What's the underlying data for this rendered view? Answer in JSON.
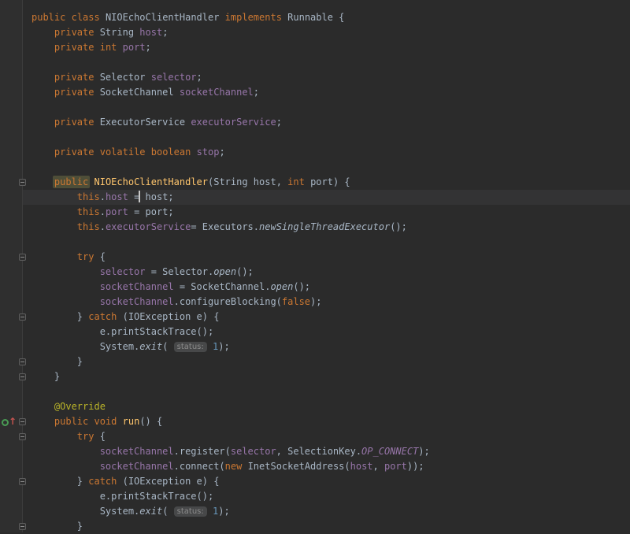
{
  "app": {
    "name": "intellij-code-editor",
    "language": "java",
    "theme": "darcula"
  },
  "colors": {
    "editor_bg": "#2B2B2B",
    "gutter_bg": "#2F2F2F",
    "gutter_border": "#3C3C3C",
    "current_line": "#333334",
    "keyword": "#CC7832",
    "text": "#A9B7C6",
    "field": "#9876AA",
    "method_decl": "#FFC66D",
    "annotation": "#BBB529",
    "number": "#6897BB",
    "hint_bg": "#474849",
    "hint_text": "#8C8C8C",
    "caret": "#C8C8C8",
    "highlight_bg": "#4E4E38",
    "fold_border": "#5E5E5E",
    "override_green": "#499C54",
    "override_red": "#C75450"
  },
  "editor": {
    "caret_line": 13,
    "gutter": {
      "fold_lines": [
        12,
        17,
        21,
        24,
        25,
        28,
        29,
        32,
        35
      ],
      "override_line": 28,
      "override_icon": "overrides-method-icon"
    },
    "lines": [
      {
        "indent": 0,
        "tokens": [
          [
            "kw",
            "public"
          ],
          [
            "txt",
            " "
          ],
          [
            "kw",
            "class"
          ],
          [
            "txt",
            " NIOEchoClientHandler "
          ],
          [
            "kw",
            "implements"
          ],
          [
            "txt",
            " Runnable {"
          ]
        ]
      },
      {
        "indent": 4,
        "tokens": [
          [
            "kw",
            "private"
          ],
          [
            "txt",
            " String "
          ],
          [
            "fld",
            "host"
          ],
          [
            "txt",
            ";"
          ]
        ]
      },
      {
        "indent": 4,
        "tokens": [
          [
            "kw",
            "private"
          ],
          [
            "txt",
            " "
          ],
          [
            "kw",
            "int"
          ],
          [
            "txt",
            " "
          ],
          [
            "fld",
            "port"
          ],
          [
            "txt",
            ";"
          ]
        ]
      },
      {
        "indent": 0,
        "tokens": []
      },
      {
        "indent": 4,
        "tokens": [
          [
            "kw",
            "private"
          ],
          [
            "txt",
            " Selector "
          ],
          [
            "fld",
            "selector"
          ],
          [
            "txt",
            ";"
          ]
        ]
      },
      {
        "indent": 4,
        "tokens": [
          [
            "kw",
            "private"
          ],
          [
            "txt",
            " SocketChannel "
          ],
          [
            "fld",
            "socketChannel"
          ],
          [
            "txt",
            ";"
          ]
        ]
      },
      {
        "indent": 0,
        "tokens": []
      },
      {
        "indent": 4,
        "tokens": [
          [
            "kw",
            "private"
          ],
          [
            "txt",
            " ExecutorService "
          ],
          [
            "fld",
            "executorService"
          ],
          [
            "txt",
            ";"
          ]
        ]
      },
      {
        "indent": 0,
        "tokens": []
      },
      {
        "indent": 4,
        "tokens": [
          [
            "kw",
            "private"
          ],
          [
            "txt",
            " "
          ],
          [
            "kw",
            "volatile"
          ],
          [
            "txt",
            " "
          ],
          [
            "kw",
            "boolean"
          ],
          [
            "txt",
            " "
          ],
          [
            "fld",
            "stop"
          ],
          [
            "txt",
            ";"
          ]
        ]
      },
      {
        "indent": 0,
        "tokens": []
      },
      {
        "indent": 4,
        "tokens": [
          [
            "hlkw",
            "public"
          ],
          [
            "txt",
            " "
          ],
          [
            "mth",
            "NIOEchoClientHandler"
          ],
          [
            "txt",
            "(String host, "
          ],
          [
            "kw",
            "int"
          ],
          [
            "txt",
            " port) {"
          ]
        ]
      },
      {
        "indent": 8,
        "tokens": [
          [
            "kw",
            "this"
          ],
          [
            "txt",
            "."
          ],
          [
            "fld",
            "host"
          ],
          [
            "txt",
            " ="
          ],
          [
            "caret",
            ""
          ],
          [
            "txt",
            " host;"
          ]
        ]
      },
      {
        "indent": 8,
        "tokens": [
          [
            "kw",
            "this"
          ],
          [
            "txt",
            "."
          ],
          [
            "fld",
            "port"
          ],
          [
            "txt",
            " = port;"
          ]
        ]
      },
      {
        "indent": 8,
        "tokens": [
          [
            "kw",
            "this"
          ],
          [
            "txt",
            "."
          ],
          [
            "fld",
            "executorService"
          ],
          [
            "txt",
            "= Executors."
          ],
          [
            "stat",
            "newSingleThreadExecutor"
          ],
          [
            "txt",
            "();"
          ]
        ]
      },
      {
        "indent": 0,
        "tokens": []
      },
      {
        "indent": 8,
        "tokens": [
          [
            "kw",
            "try"
          ],
          [
            "txt",
            " {"
          ]
        ]
      },
      {
        "indent": 12,
        "tokens": [
          [
            "fld",
            "selector"
          ],
          [
            "txt",
            " = Selector."
          ],
          [
            "stat",
            "open"
          ],
          [
            "txt",
            "();"
          ]
        ]
      },
      {
        "indent": 12,
        "tokens": [
          [
            "fld",
            "socketChannel"
          ],
          [
            "txt",
            " = SocketChannel."
          ],
          [
            "stat",
            "open"
          ],
          [
            "txt",
            "();"
          ]
        ]
      },
      {
        "indent": 12,
        "tokens": [
          [
            "fld",
            "socketChannel"
          ],
          [
            "txt",
            ".configureBlocking("
          ],
          [
            "kw",
            "false"
          ],
          [
            "txt",
            ");"
          ]
        ]
      },
      {
        "indent": 8,
        "tokens": [
          [
            "txt",
            "} "
          ],
          [
            "kw",
            "catch"
          ],
          [
            "txt",
            " (IOException e) {"
          ]
        ]
      },
      {
        "indent": 12,
        "tokens": [
          [
            "txt",
            "e.printStackTrace();"
          ]
        ]
      },
      {
        "indent": 12,
        "tokens": [
          [
            "txt",
            "System."
          ],
          [
            "stat",
            "exit"
          ],
          [
            "txt",
            "( "
          ],
          [
            "badge",
            "status:"
          ],
          [
            "txt",
            " "
          ],
          [
            "num",
            "1"
          ],
          [
            "txt",
            ");"
          ]
        ]
      },
      {
        "indent": 8,
        "tokens": [
          [
            "txt",
            "}"
          ]
        ]
      },
      {
        "indent": 4,
        "tokens": [
          [
            "txt",
            "}"
          ]
        ]
      },
      {
        "indent": 0,
        "tokens": []
      },
      {
        "indent": 4,
        "tokens": [
          [
            "ann",
            "@Override"
          ]
        ]
      },
      {
        "indent": 4,
        "tokens": [
          [
            "kw",
            "public"
          ],
          [
            "txt",
            " "
          ],
          [
            "kw",
            "void"
          ],
          [
            "txt",
            " "
          ],
          [
            "mth",
            "run"
          ],
          [
            "txt",
            "() {"
          ]
        ]
      },
      {
        "indent": 8,
        "tokens": [
          [
            "kw",
            "try"
          ],
          [
            "txt",
            " {"
          ]
        ]
      },
      {
        "indent": 12,
        "tokens": [
          [
            "fld",
            "socketChannel"
          ],
          [
            "txt",
            ".register("
          ],
          [
            "fld",
            "selector"
          ],
          [
            "txt",
            ", SelectionKey."
          ],
          [
            "sfld",
            "OP_CONNECT"
          ],
          [
            "txt",
            ");"
          ]
        ]
      },
      {
        "indent": 12,
        "tokens": [
          [
            "fld",
            "socketChannel"
          ],
          [
            "txt",
            ".connect("
          ],
          [
            "kw",
            "new"
          ],
          [
            "txt",
            " InetSocketAddress("
          ],
          [
            "fld",
            "host"
          ],
          [
            "txt",
            ", "
          ],
          [
            "fld",
            "port"
          ],
          [
            "txt",
            "));"
          ]
        ]
      },
      {
        "indent": 8,
        "tokens": [
          [
            "txt",
            "} "
          ],
          [
            "kw",
            "catch"
          ],
          [
            "txt",
            " (IOException e) {"
          ]
        ]
      },
      {
        "indent": 12,
        "tokens": [
          [
            "txt",
            "e.printStackTrace();"
          ]
        ]
      },
      {
        "indent": 12,
        "tokens": [
          [
            "txt",
            "System."
          ],
          [
            "stat",
            "exit"
          ],
          [
            "txt",
            "( "
          ],
          [
            "badge",
            "status:"
          ],
          [
            "txt",
            " "
          ],
          [
            "num",
            "1"
          ],
          [
            "txt",
            ");"
          ]
        ]
      },
      {
        "indent": 8,
        "tokens": [
          [
            "txt",
            "}"
          ]
        ]
      }
    ]
  }
}
